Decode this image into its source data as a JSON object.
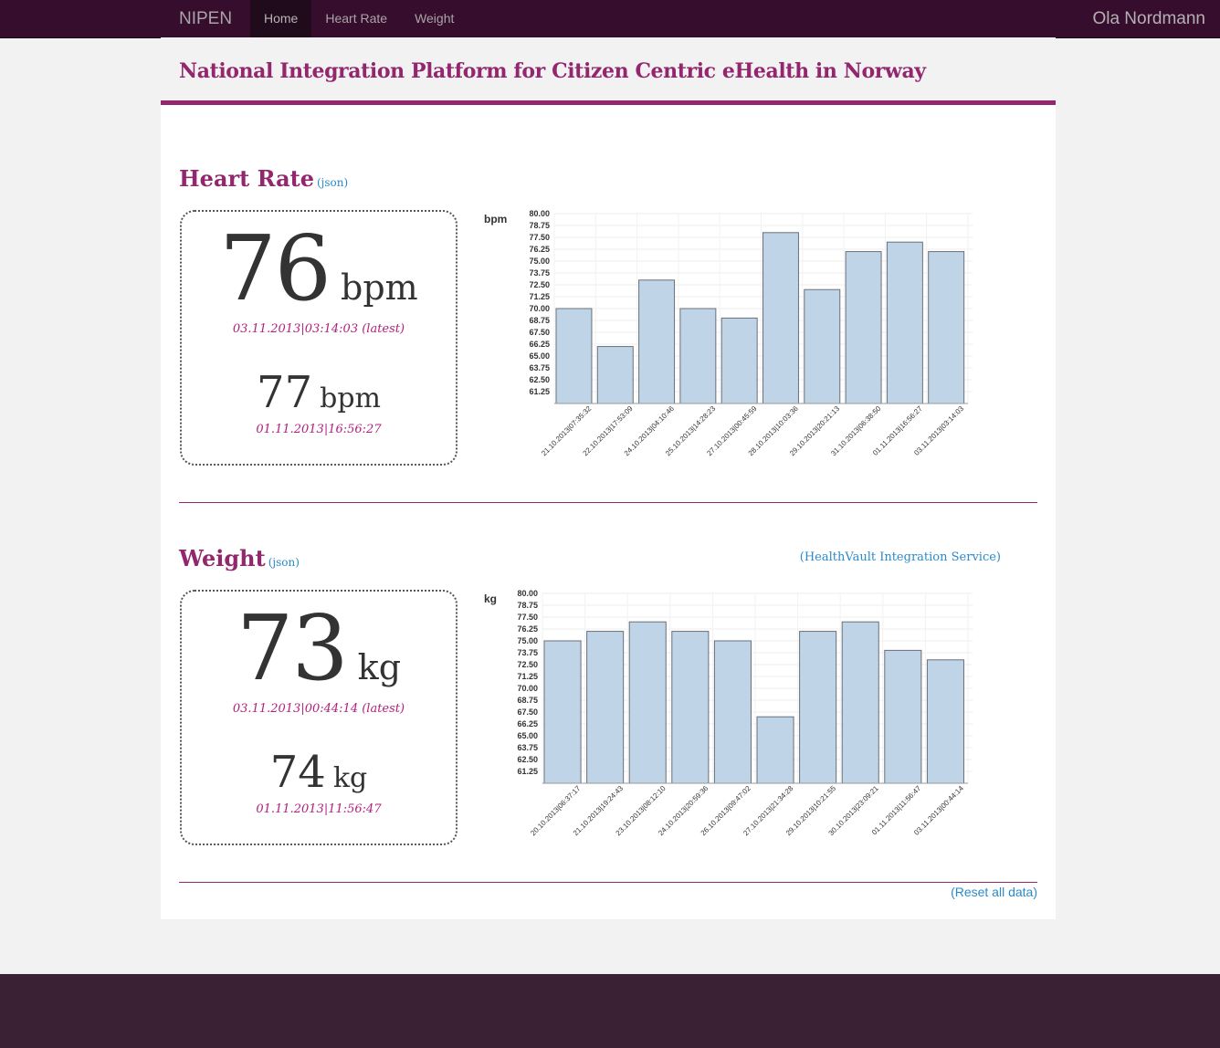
{
  "nav": {
    "brand": "NIPEN",
    "items": [
      {
        "label": "Home",
        "active": true
      },
      {
        "label": "Heart Rate",
        "active": false
      },
      {
        "label": "Weight",
        "active": false
      }
    ],
    "user": "Ola Nordmann"
  },
  "page_title": "National Integration Platform for Citizen Centric eHealth in Norway",
  "heart_rate": {
    "title": "Heart Rate",
    "json_link": "(json)",
    "latest_value": "76",
    "latest_unit": "bpm",
    "latest_time": "03.11.2013|03:14:03 (latest)",
    "previous_value": "77",
    "previous_unit": "bpm",
    "previous_time": "01.11.2013|16:56:27"
  },
  "weight": {
    "title": "Weight",
    "json_link": "(json)",
    "service_link": "(HealthVault Integration Service)",
    "latest_value": "73",
    "latest_unit": "kg",
    "latest_time": "03.11.2013|00:44:14 (latest)",
    "previous_value": "74",
    "previous_unit": "kg",
    "previous_time": "01.11.2013|11:56:47"
  },
  "reset_link": "(Reset all data)",
  "colors": {
    "accent": "#93276e",
    "link": "#2a8ac9",
    "bar": "#c0d4e8",
    "navbar": "#360d2c"
  },
  "chart_data": [
    {
      "type": "bar",
      "title": "",
      "ylabel": "bpm",
      "xlabel": "",
      "ylim": [
        60,
        80
      ],
      "yticks": [
        "61.25",
        "62.50",
        "63.75",
        "65.00",
        "66.25",
        "67.50",
        "68.75",
        "70.00",
        "71.25",
        "72.50",
        "73.75",
        "75.00",
        "76.25",
        "77.50",
        "78.75",
        "80.00"
      ],
      "categories": [
        "21.10.2013|07:35:32",
        "22.10.2013|17:53:09",
        "24.10.2013|04:10:46",
        "25.10.2013|14:28:23",
        "27.10.2013|00:45:59",
        "28.10.2013|10:03:36",
        "29.10.2013|20:21:13",
        "31.10.2013|06:38:50",
        "01.11.2013|16:56:27",
        "03.11.2013|03:14:03"
      ],
      "values": [
        70,
        66,
        73,
        70,
        69,
        78,
        72,
        76,
        77,
        76
      ]
    },
    {
      "type": "bar",
      "title": "",
      "ylabel": "kg",
      "xlabel": "",
      "ylim": [
        60,
        80
      ],
      "yticks": [
        "61.25",
        "62.50",
        "63.75",
        "65.00",
        "66.25",
        "67.50",
        "68.75",
        "70.00",
        "71.25",
        "72.50",
        "73.75",
        "75.00",
        "76.25",
        "77.50",
        "78.75",
        "80.00"
      ],
      "categories": [
        "20.10.2013|06:37:17",
        "21.10.2013|19:24:43",
        "23.10.2013|08:12:10",
        "24.10.2013|20:59:36",
        "26.10.2013|09:47:02",
        "27.10.2013|21:34:28",
        "29.10.2013|10:21:55",
        "30.10.2013|23:09:21",
        "01.11.2013|11:56:47",
        "03.11.2013|00:44:14"
      ],
      "values": [
        75,
        76,
        77,
        76,
        75,
        67,
        76,
        77,
        74,
        73
      ]
    }
  ]
}
